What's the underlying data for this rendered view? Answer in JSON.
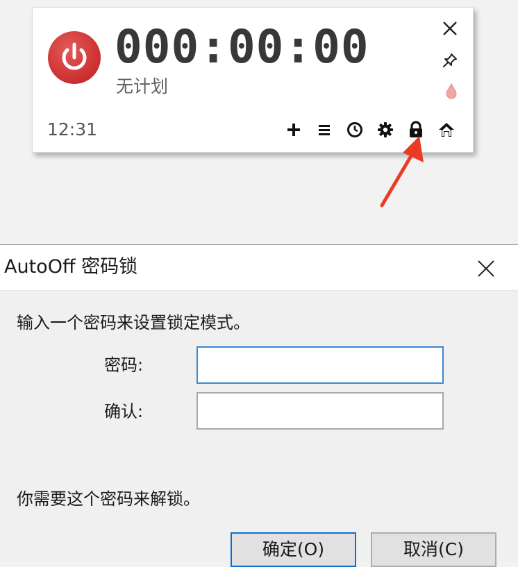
{
  "timer": {
    "display": "000:00:00",
    "plan": "无计划",
    "clock": "12:31"
  },
  "widget_icons": {
    "side": [
      "close-icon",
      "pin-icon",
      "drop-icon"
    ],
    "toolbar": [
      "add-icon",
      "menu-icon",
      "clock-icon",
      "gear-icon",
      "lock-icon",
      "home-icon"
    ]
  },
  "colors": {
    "power_button": "#cf3434",
    "arrow": "#ea3b24",
    "focus_border": "#3a86d6",
    "default_button_border": "#0a6fd1"
  },
  "dialog": {
    "title": "AutoOff 密码锁",
    "instruction": "输入一个密码来设置锁定模式。",
    "password_label": "密码:",
    "confirm_label": "确认:",
    "password_value": "",
    "confirm_value": "",
    "hint": "你需要这个密码来解锁。",
    "ok_label": "确定(O)",
    "cancel_label": "取消(C)"
  }
}
